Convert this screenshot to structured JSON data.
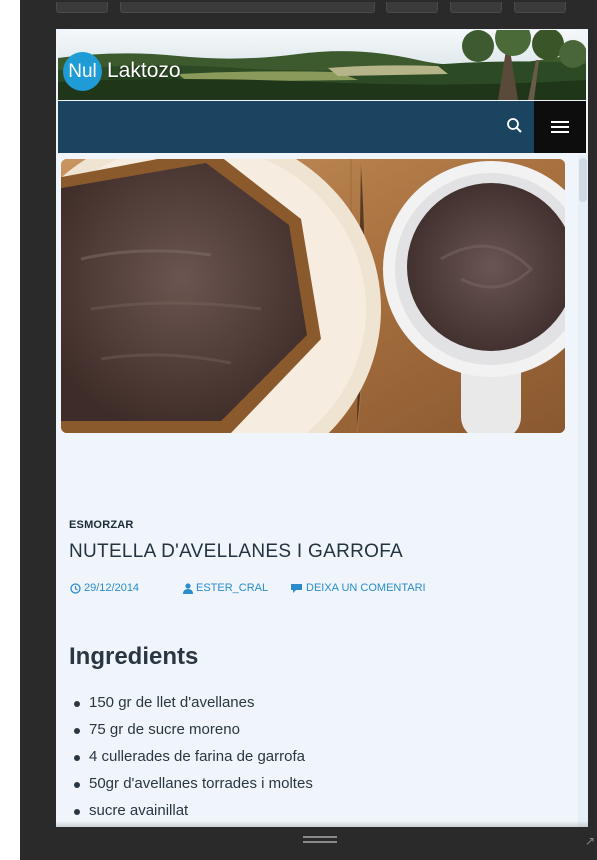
{
  "site": {
    "logo_mark": "Nul",
    "logo_name": "Laktozo"
  },
  "nav": {
    "search_icon": "search-icon",
    "menu_icon": "hamburger-menu-icon"
  },
  "hero": {
    "image_subject": "bread-with-spread-and-bowl-image"
  },
  "post": {
    "category": "ESMORZAR",
    "title": "NUTELLA D'AVELLANES I GARROFA",
    "date": "29/12/2014",
    "author": "ESTER_CRAL",
    "comment_link": "DEIXA UN COMENTARI"
  },
  "ingredients": {
    "heading": "Ingredients",
    "items": [
      "150 gr de llet d'avellanes",
      "75 gr de sucre moreno",
      "4 cullerades de farina de garrofa",
      "50gr d'avellanes torrades i moltes",
      "sucre avainillat"
    ]
  },
  "colors": {
    "navbar": "#1b4461",
    "accent": "#2a8ccc",
    "logo": "#1f9bd6",
    "page_background": "#eff5fa"
  }
}
